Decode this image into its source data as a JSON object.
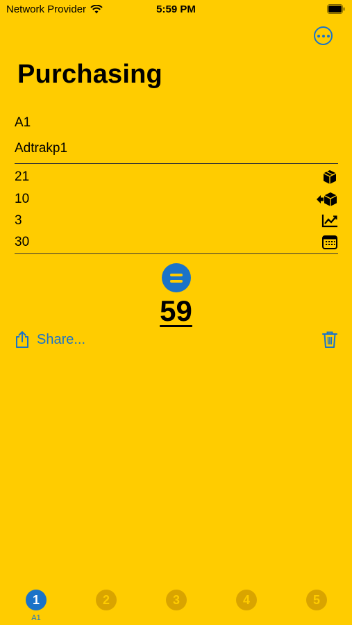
{
  "status_bar": {
    "carrier": "Network Provider",
    "time": "5:59 PM"
  },
  "header": {
    "title": "Purchasing",
    "more_icon": "ellipsis-circle-icon"
  },
  "fields": {
    "code": "A1",
    "name": "Adtrakp1"
  },
  "rows": [
    {
      "value": "21",
      "icon": "box-icon"
    },
    {
      "value": "10",
      "icon": "box-transfer-icon"
    },
    {
      "value": "3",
      "icon": "chart-line-icon"
    },
    {
      "value": "30",
      "icon": "calendar-icon"
    }
  ],
  "result": {
    "equals_icon": "equals-icon",
    "value": "59"
  },
  "actions": {
    "share_label": "Share...",
    "share_icon": "share-icon",
    "trash_icon": "trash-icon"
  },
  "tabs": [
    {
      "number": "1",
      "label": "A1",
      "active": true
    },
    {
      "number": "2",
      "label": "",
      "active": false
    },
    {
      "number": "3",
      "label": "",
      "active": false
    },
    {
      "number": "4",
      "label": "",
      "active": false
    },
    {
      "number": "5",
      "label": "",
      "active": false
    }
  ],
  "colors": {
    "background": "#FFCC00",
    "accent": "#1A73C8"
  }
}
